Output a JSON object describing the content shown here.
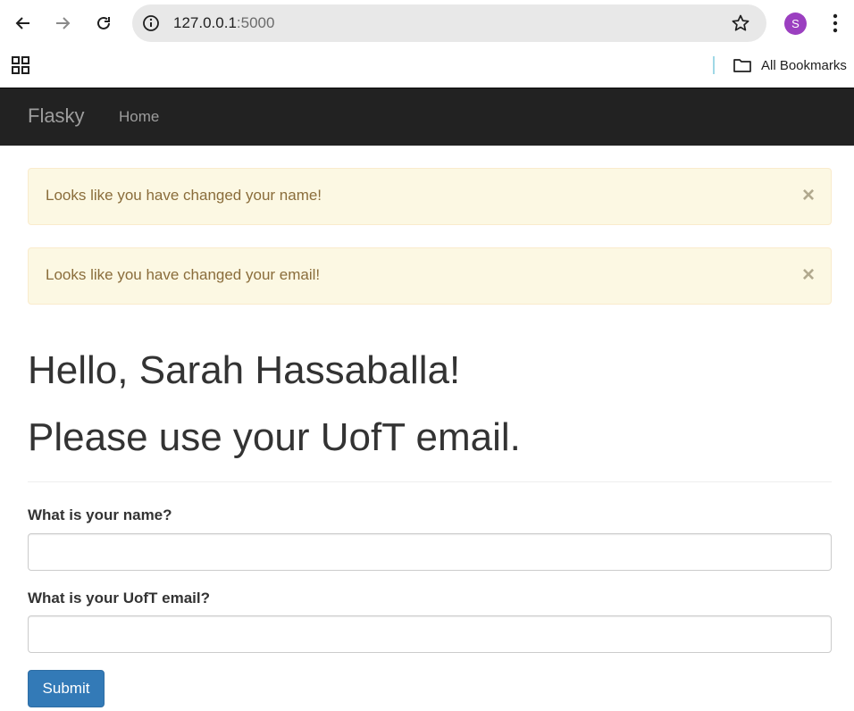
{
  "browser": {
    "url_host": "127.0.0.1",
    "url_port": ":5000",
    "profile_initial": "S",
    "bookmarks_label": "All Bookmarks",
    "avatar_color": "#9b3fc0"
  },
  "navbar": {
    "brand": "Flasky",
    "links": [
      "Home"
    ]
  },
  "alerts": [
    {
      "message": "Looks like you have changed your name!",
      "close": "×"
    },
    {
      "message": "Looks like you have changed your email!",
      "close": "×"
    }
  ],
  "page": {
    "greeting": "Hello, Sarah Hassaballa!",
    "subheading": "Please use your UofT email."
  },
  "form": {
    "name_label": "What is your name?",
    "name_value": "",
    "email_label": "What is your UofT email?",
    "email_value": "",
    "submit_label": "Submit"
  },
  "colors": {
    "navbar_bg": "#222222",
    "alert_bg": "#fcf8e3",
    "alert_text": "#8a6d3b",
    "primary_button": "#337ab7"
  }
}
